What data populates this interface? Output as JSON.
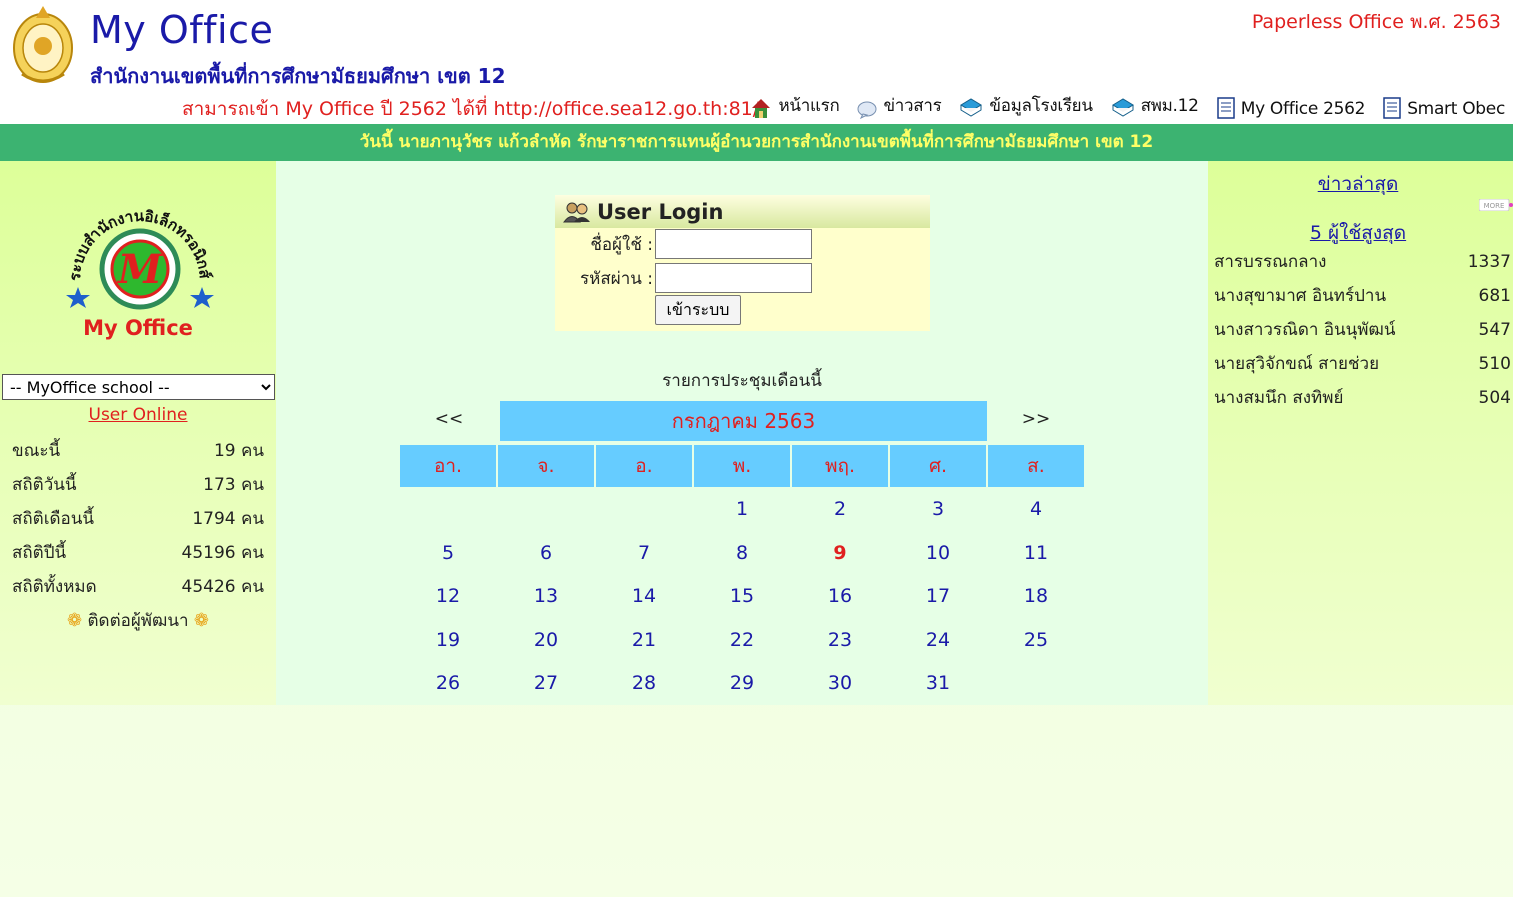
{
  "header": {
    "title": "My Office",
    "subtitle": "สำนักงานเขตพื้นที่การศึกษามัธยมศึกษา เขต 12",
    "paperless": "Paperless Office พ.ศ. 2563",
    "access_note": "สามารถเข้า My Office ปี 2562 ได้ที่ http://office.sea12.go.th:81/"
  },
  "nav": [
    {
      "label": "หน้าแรก",
      "icon": "house-icon"
    },
    {
      "label": "ข่าวสาร",
      "icon": "speech-bubble-icon"
    },
    {
      "label": "ข้อมูลโรงเรียน",
      "icon": "book-icon"
    },
    {
      "label": "สพม.12",
      "icon": "book-icon"
    },
    {
      "label": "My Office 2562",
      "icon": "document-icon"
    },
    {
      "label": "Smart Obec",
      "icon": "document-icon"
    }
  ],
  "announcement": "วันนี้ นายภานุวัชร แก้วลำหัด รักษาราชการแทนผู้อำนวยการสำนักงานเขตพื้นที่การศึกษามัธยมศึกษา เขต 12",
  "left": {
    "logo_text": "My Office",
    "logo_ring_text": "ระบบสำนักงานอิเล็กทรอนิกส์",
    "school_select": "-- MyOffice school --",
    "user_online": "User Online",
    "stats": [
      {
        "label": "ขณะนี้",
        "value": "19 คน"
      },
      {
        "label": "สถิติวันนี้",
        "value": "173 คน"
      },
      {
        "label": "สถิติเดือนนี้",
        "value": "1794 คน"
      },
      {
        "label": "สถิติปีนี้",
        "value": "45196 คน"
      },
      {
        "label": "สถิติทั้งหมด",
        "value": "45426 คน"
      }
    ],
    "contact_dev": "ติดต่อผู้พัฒนา"
  },
  "login": {
    "title": "User Login",
    "username_label": "ชื่อผู้ใช้ :",
    "password_label": "รหัสผ่าน :",
    "submit": "เข้าระบบ"
  },
  "calendar": {
    "caption": "รายการประชุมเดือนนี้",
    "prev": "<<",
    "next": ">>",
    "month": "กรกฎาคม 2563",
    "weekdays": [
      "อา.",
      "จ.",
      "อ.",
      "พ.",
      "พฤ.",
      "ศ.",
      "ส."
    ],
    "first_weekday_index": 3,
    "days_in_month": 31,
    "highlight_day": 9
  },
  "right": {
    "latest_news": "ข่าวล่าสุด",
    "more": "MORE",
    "top5_title": "5 ผู้ใช้สูงสุด",
    "top5": [
      {
        "name": "สารบรรณกลาง",
        "count": "1337"
      },
      {
        "name": "นางสุขามาศ อินทร์ปาน",
        "count": "681"
      },
      {
        "name": "นางสาวรณิดา อินนุพัฒน์",
        "count": "547"
      },
      {
        "name": "นายสุวิจักขณ์ สายช่วย",
        "count": "510"
      },
      {
        "name": "นางสมนึก สงทิพย์",
        "count": "504"
      }
    ]
  },
  "colors": {
    "brand_blue": "#1a1aa8",
    "accent_red": "#e0201f",
    "bar_green": "#3cb371",
    "calendar_blue": "#66ccff"
  }
}
